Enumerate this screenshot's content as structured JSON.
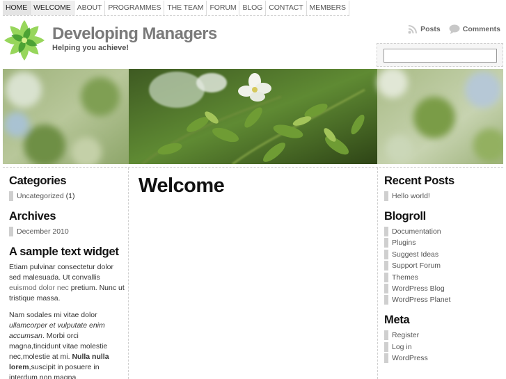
{
  "nav": {
    "items": [
      {
        "label": "HOME",
        "state": "active"
      },
      {
        "label": "WELCOME",
        "state": "hover"
      },
      {
        "label": "ABOUT",
        "state": ""
      },
      {
        "label": "PROGRAMMES",
        "state": ""
      },
      {
        "label": "THE TEAM",
        "state": ""
      },
      {
        "label": "FORUM",
        "state": ""
      },
      {
        "label": "BLOG",
        "state": ""
      },
      {
        "label": "CONTACT",
        "state": ""
      },
      {
        "label": "MEMBERS",
        "state": ""
      }
    ]
  },
  "header": {
    "title": "Developing Managers",
    "tagline": "Helping you achieve!",
    "logo_icon": "green-leaf-flower-logo",
    "feeds": {
      "posts_label": "Posts",
      "comments_label": "Comments"
    },
    "search": {
      "value": "",
      "placeholder": ""
    }
  },
  "main": {
    "page_title": "Welcome"
  },
  "sidebar_left": {
    "categories": {
      "title": "Categories",
      "items": [
        {
          "label": "Uncategorized",
          "count": "(1)"
        }
      ]
    },
    "archives": {
      "title": "Archives",
      "items": [
        {
          "label": "December 2010"
        }
      ]
    },
    "text_widget": {
      "title": "A sample text widget",
      "p1_a": "Etiam pulvinar consectetur dolor sed malesuada. Ut convallis ",
      "p1_b": "euismod dolor nec",
      "p1_c": " pretium. Nunc ut tristique massa.",
      "p2_a": "Nam sodales mi vitae dolor ",
      "p2_b": "ullamcorper et vulputate enim accumsan",
      "p2_c": ". Morbi orci magna,tincidunt vitae molestie nec,molestie at mi. ",
      "p2_d": "Nulla nulla lorem",
      "p2_e": ",suscipit in posuere in interdum non magna."
    }
  },
  "sidebar_right": {
    "recent_posts": {
      "title": "Recent Posts",
      "items": [
        {
          "label": "Hello world!"
        }
      ]
    },
    "blogroll": {
      "title": "Blogroll",
      "items": [
        {
          "label": "Documentation"
        },
        {
          "label": "Plugins"
        },
        {
          "label": "Suggest Ideas"
        },
        {
          "label": "Support Forum"
        },
        {
          "label": "Themes"
        },
        {
          "label": "WordPress Blog"
        },
        {
          "label": "WordPress Planet"
        }
      ]
    },
    "meta": {
      "title": "Meta",
      "items": [
        {
          "label": "Register"
        },
        {
          "label": "Log in"
        },
        {
          "label": "WordPress"
        }
      ]
    }
  },
  "colors": {
    "leaf_dark": "#3f9a2e",
    "leaf_light": "#8cd24a",
    "title_gray": "#7a7a7a",
    "bullet_gray": "#cfcfcf"
  }
}
